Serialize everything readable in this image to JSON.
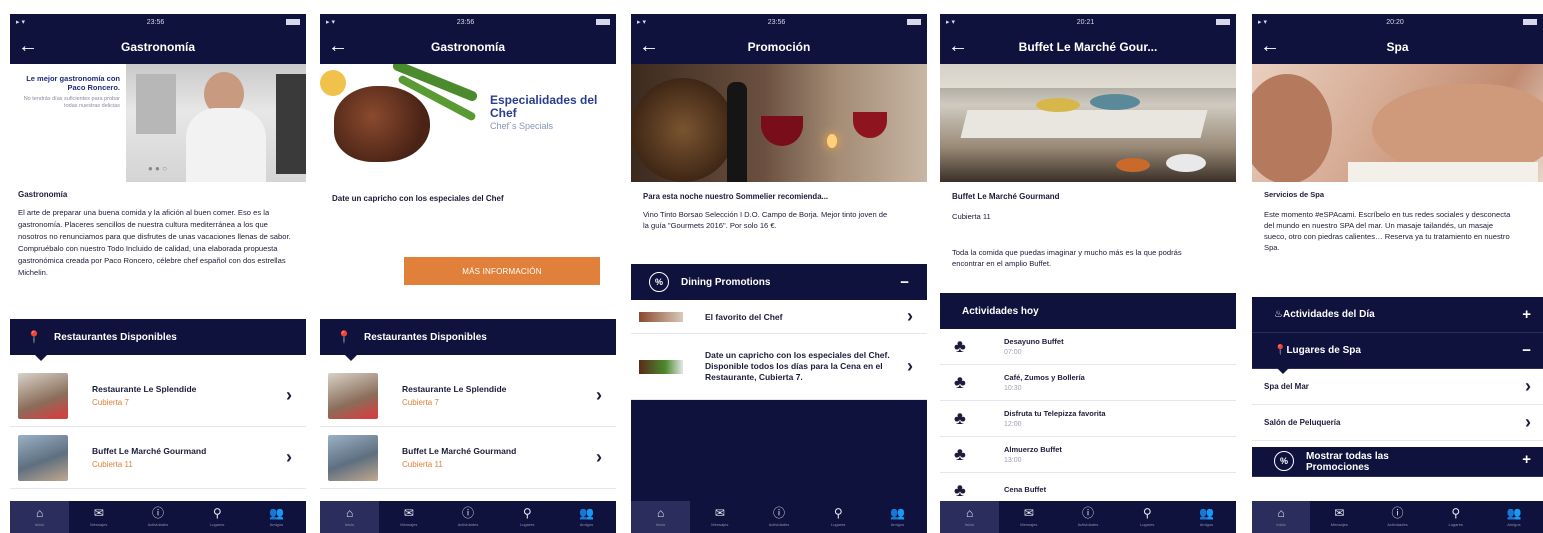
{
  "status": {
    "time1": "23:56",
    "time2": "23:56",
    "time3": "23:56",
    "time4": "20:21",
    "time5": "20:20"
  },
  "tabbar": {
    "items": [
      {
        "icon": "home-icon",
        "glyph": "⌂",
        "label": "Inicio"
      },
      {
        "icon": "mail-icon",
        "glyph": "✉",
        "label": "Mensajes"
      },
      {
        "icon": "info-icon",
        "glyph": "ⓘ",
        "label": "Actividades"
      },
      {
        "icon": "location-icon",
        "glyph": "⚲",
        "label": "Lugares"
      },
      {
        "icon": "people-icon",
        "glyph": "👥",
        "label": "Amigos"
      }
    ]
  },
  "screen1": {
    "title": "Gastronomía",
    "hero_headline": "Le mejor gastronomía con Paco Roncero.",
    "hero_sub": "No tendrás días suficientes para probar todas nuestras delicias",
    "section_title": "Gastronomía",
    "body": "El arte de preparar una buena comida y la afición al buen comer. Eso es la gastronomía. Placeres sencillos de nuestra cultura mediterránea a los que nosotros no renunciamos para que disfrutes de unas vacaciones llenas de sabor. Compruébalo con nuestro Todo Incluido de calidad, una elaborada propuesta gastronómica creada por Paco Roncero, célebre chef español con dos estrellas Michelin.",
    "bar_label": "Restaurantes Disponibles",
    "items": [
      {
        "name": "Restaurante Le Splendide",
        "sub": "Cubierta 7"
      },
      {
        "name": "Buffet Le Marché Gourmand",
        "sub": "Cubierta 11"
      }
    ]
  },
  "screen2": {
    "title": "Gastronomía",
    "hero_title": "Especialidades del Chef",
    "hero_sub": "Chef´s Specials",
    "headline": "Date un capricho con los especiales del Chef",
    "button": "MÁS INFORMACIÓN",
    "bar_label": "Restaurantes Disponibles",
    "items": [
      {
        "name": "Restaurante Le Splendide",
        "sub": "Cubierta 7"
      },
      {
        "name": "Buffet Le Marché Gourmand",
        "sub": "Cubierta 11"
      }
    ]
  },
  "screen3": {
    "title": "Promoción",
    "headline": "Para esta noche nuestro Sommelier recomienda...",
    "body": "Vino Tinto Borsao Selección I D.O. Campo de Borja. Mejor tinto joven de la guía \"Gourmets 2016\". Por solo 16 €.",
    "bar_label": "Dining Promotions",
    "bar_sign": "−",
    "items": [
      {
        "name": "El favorito del Chef"
      },
      {
        "name": "Date un capricho con los especiales del Chef. Disponible todos los días para la Cena en el Restaurante, Cubierta 7."
      }
    ]
  },
  "screen4": {
    "title": "Buffet Le Marché Gour...",
    "name": "Buffet Le Marché Gourmand",
    "deck": "Cubierta 11",
    "body": "Toda la comida que puedas imaginar y mucho más es la que podrás encontrar en el amplio Buffet.",
    "bar_label": "Actividades hoy",
    "activities": [
      {
        "name": "Desayuno Buffet",
        "time": "07:00"
      },
      {
        "name": "Café, Zumos y Bollería",
        "time": "10:30"
      },
      {
        "name": "Disfruta tu Telepizza favorita",
        "time": "12:00"
      },
      {
        "name": "Almuerzo Buffet",
        "time": "13:00"
      },
      {
        "name": "Cena Buffet",
        "time": ""
      }
    ]
  },
  "screen5": {
    "title": "Spa",
    "section_title": "Servicios de Spa",
    "body": "Este momento #eSPAcami. Escríbelo en tus redes sociales y desconecta del mundo en nuestro SPA del mar. Un masaje tailandés, un masaje sueco, otro con piedras calientes… Reserva ya tu tratamiento en nuestro Spa.",
    "bar1": "Actividades del Día",
    "bar1_sign": "+",
    "bar2": "Lugares de Spa",
    "bar2_sign": "−",
    "items": [
      {
        "name": "Spa del Mar"
      },
      {
        "name": "Salón de Peluquería"
      }
    ],
    "bar3": "Mostrar todas las Promociones",
    "bar3_sign": "+"
  }
}
